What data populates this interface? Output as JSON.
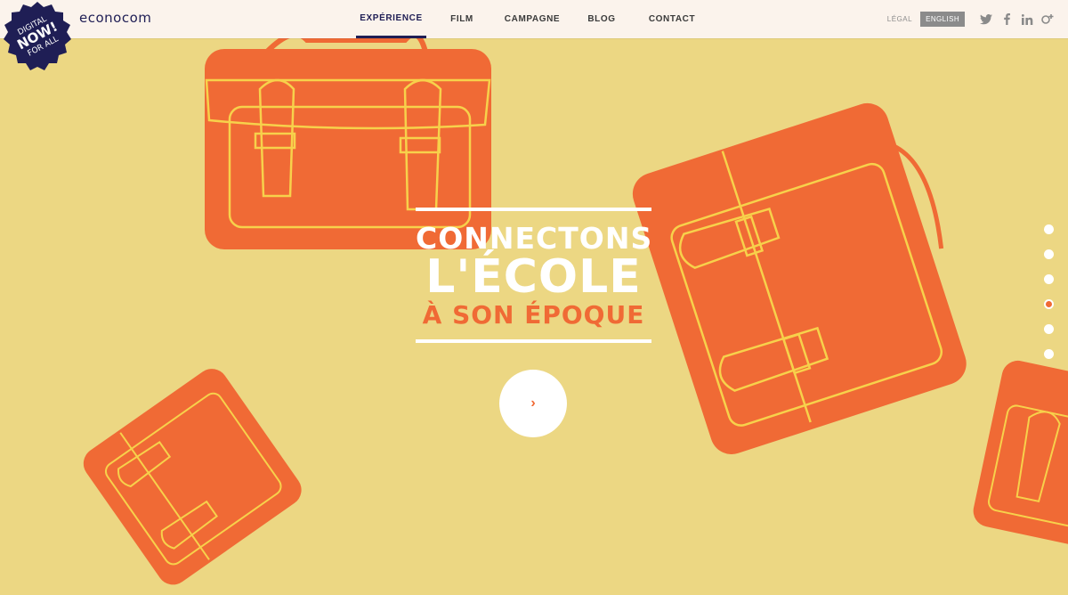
{
  "brand": {
    "badge_lines": [
      "DIGITAL",
      "NOW!",
      "FOR ALL"
    ],
    "logo_text": "econocom"
  },
  "nav": {
    "items": [
      {
        "label": "EXPÉRIENCE",
        "active": true
      },
      {
        "label": "FILM",
        "active": false
      },
      {
        "label": "CAMPAGNE",
        "active": false
      },
      {
        "label": "BLOG",
        "active": false
      },
      {
        "label": "CONTACT",
        "active": false
      }
    ]
  },
  "tools": {
    "legal": "LÉGAL",
    "language": "ENGLISH",
    "social_icons": [
      "twitter-icon",
      "facebook-icon",
      "linkedin-icon",
      "google-plus-icon"
    ]
  },
  "hero": {
    "line1": "CONNECTONS",
    "line2": "L'ÉCOLE",
    "line3": "À SON ÉPOQUE",
    "play_icon": "chevron-right-icon"
  },
  "pager": {
    "count": 6,
    "active_index": 3
  },
  "colors": {
    "background": "#ecd783",
    "bag_orange": "#f06a35",
    "bag_outline": "#f7d14b",
    "navy": "#1f1e55",
    "accent_orange": "#f06a35"
  }
}
